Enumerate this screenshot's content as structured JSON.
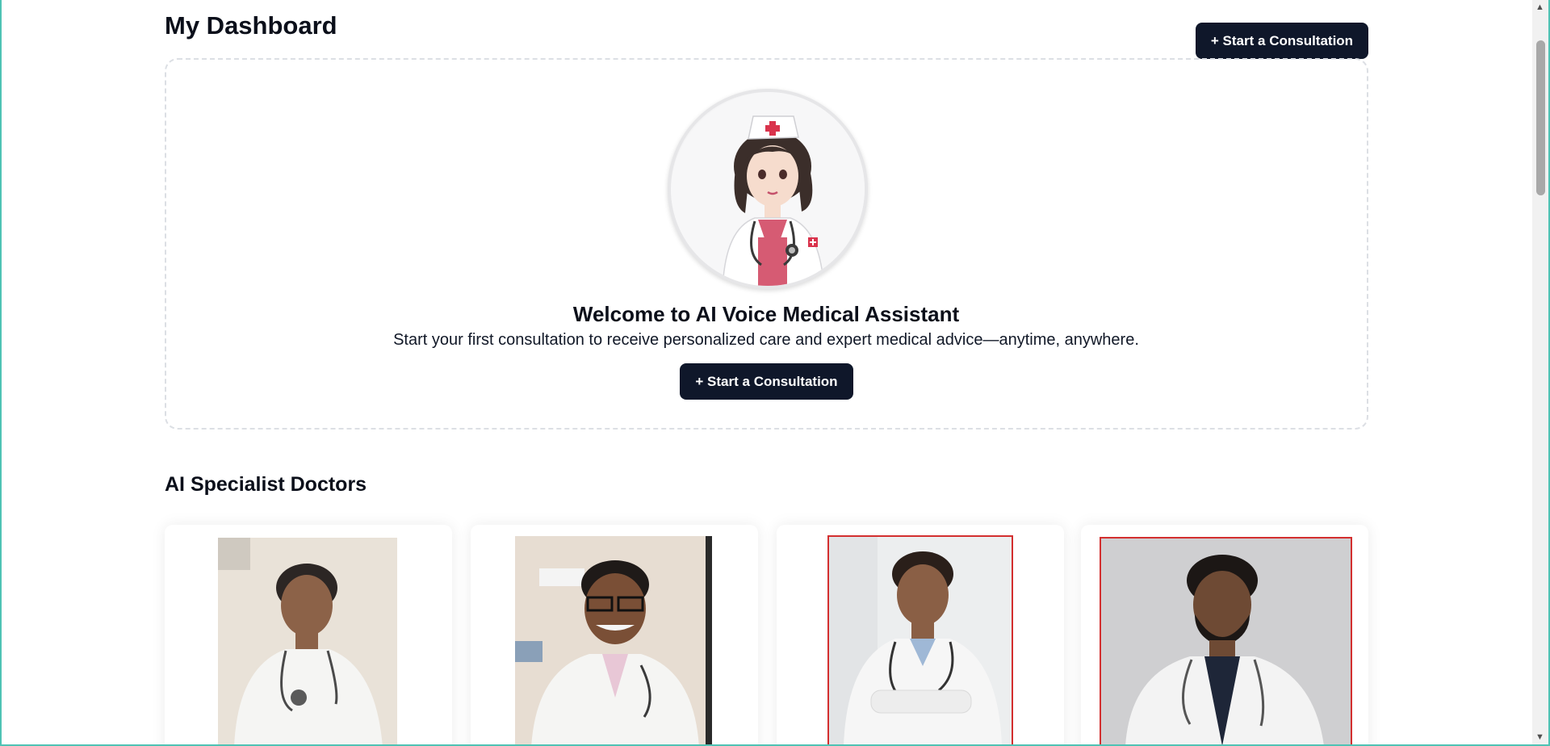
{
  "header": {
    "title": "My Dashboard",
    "cta_label": "+ Start a Consultation"
  },
  "empty_state": {
    "title": "Welcome to AI Voice Medical Assistant",
    "subtitle": "Start your first consultation to receive personalized care and expert medical advice—anytime, anywhere.",
    "cta_label": "+ Start a Consultation",
    "avatar_icon": "nurse-illustration"
  },
  "specialists": {
    "title": "AI Specialist Doctors",
    "doctors": [
      {
        "photo": "doctor-photo-1"
      },
      {
        "photo": "doctor-photo-2"
      },
      {
        "photo": "doctor-photo-3"
      },
      {
        "photo": "doctor-photo-4"
      }
    ]
  },
  "colors": {
    "accent": "#0f172a",
    "frame": "#4fc3b4",
    "photo_border": "#d32f2f"
  }
}
